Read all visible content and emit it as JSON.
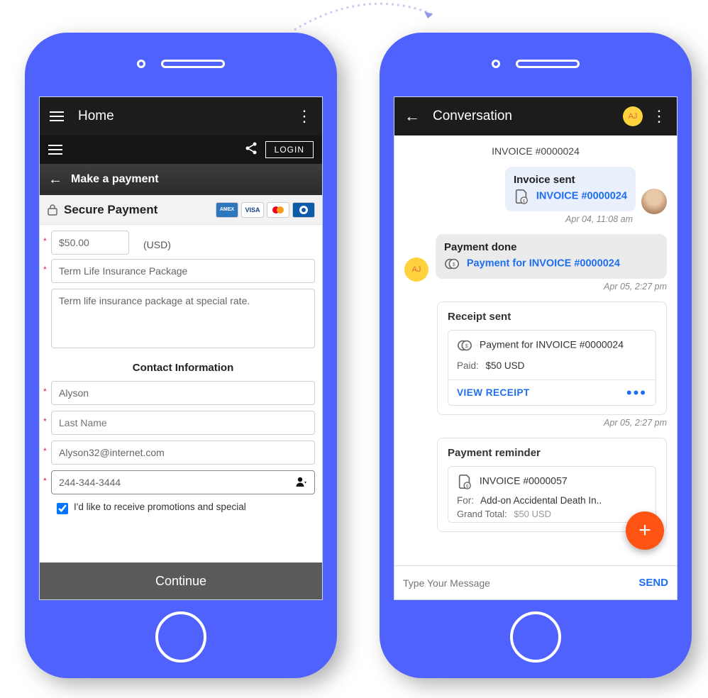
{
  "colors": {
    "frame": "#4f62fe",
    "link": "#1d6ef0",
    "fab": "#ff5414",
    "avatar_bg": "#ffd23e"
  },
  "left": {
    "appbar_title": "Home",
    "login_label": "LOGIN",
    "make_payment_title": "Make a payment",
    "secure_label": "Secure Payment",
    "card_brands": [
      "AMEX",
      "VISA",
      "mastercard",
      "Diners"
    ],
    "amount_value": "$50.00",
    "amount_currency": "(USD)",
    "package_value": "Term Life Insurance Package",
    "description_value": "Term life insurance package at special rate.",
    "contact_heading": "Contact Information",
    "first_name_value": "Alyson",
    "last_name_placeholder": "Last Name",
    "email_value": "Alyson32@internet.com",
    "phone_value": "244-344-3444",
    "promo_label": "I'd like to receive promotions and special",
    "promo_checked": true,
    "continue_label": "Continue"
  },
  "right": {
    "appbar_title": "Conversation",
    "avatar_initials": "AJ",
    "invoice_header": "INVOICE #0000024",
    "msg_invoice_sent": {
      "title": "Invoice sent",
      "link": "INVOICE #0000024",
      "time": "Apr 04, 11:08 am"
    },
    "msg_payment_done": {
      "title": "Payment done",
      "link": "Payment for INVOICE #0000024",
      "time": "Apr 05, 2:27 pm"
    },
    "msg_receipt": {
      "title": "Receipt sent",
      "link": "Payment for INVOICE #0000024",
      "paid_label": "Paid:",
      "paid_value": "$50 USD",
      "view_label": "VIEW RECEIPT",
      "time": "Apr 05, 2:27 pm"
    },
    "msg_reminder": {
      "title": "Payment reminder",
      "link": "INVOICE  #0000057",
      "for_label": "For:",
      "for_value": "Add-on Accidental Death In..",
      "total_label": "Grand Total:",
      "total_value": "$50 USD"
    },
    "compose_placeholder": "Type Your Message",
    "send_label": "SEND"
  }
}
